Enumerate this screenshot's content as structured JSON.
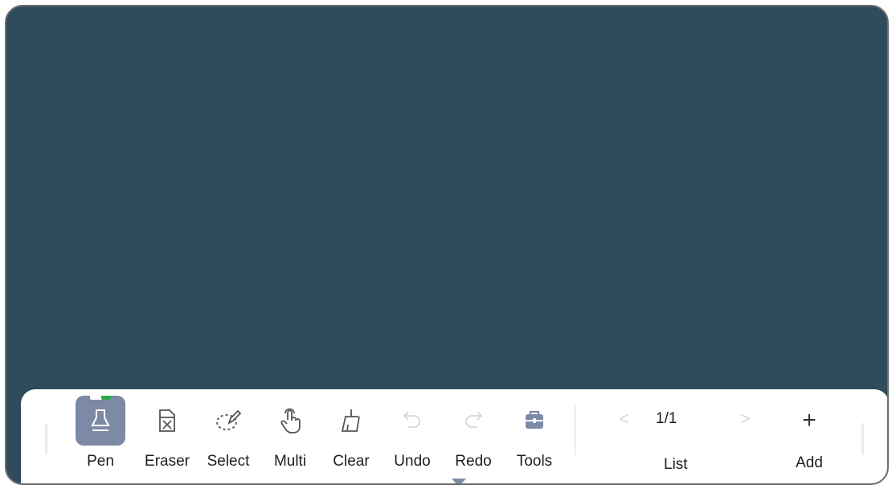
{
  "toolbar": {
    "tools": [
      {
        "label": "Pen",
        "icon": "pen-icon",
        "active": true
      },
      {
        "label": "Eraser",
        "icon": "eraser-icon"
      },
      {
        "label": "Select",
        "icon": "lasso-select-icon"
      },
      {
        "label": "Multi",
        "icon": "multi-touch-icon"
      },
      {
        "label": "Clear",
        "icon": "broom-icon"
      },
      {
        "label": "Undo",
        "icon": "undo-icon",
        "disabled": true
      },
      {
        "label": "Redo",
        "icon": "redo-icon",
        "disabled": true
      },
      {
        "label": "Tools",
        "icon": "toolbox-icon"
      }
    ],
    "pages": {
      "current": "1/1",
      "label": "List"
    },
    "add": {
      "label": "Add",
      "icon": "plus-icon"
    }
  },
  "colors": {
    "canvas": "#2e4c5c",
    "active_tool": "#7d8aa6",
    "pen_color_indicator": "#2fa84f",
    "disabled_icon": "#d6d6d6"
  }
}
